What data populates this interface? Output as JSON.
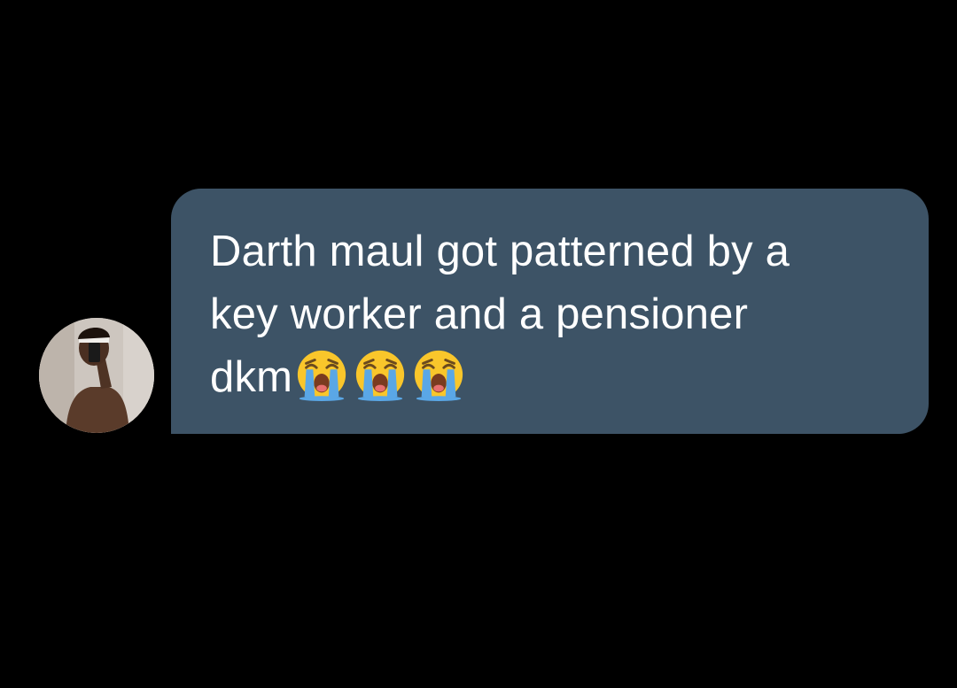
{
  "message": {
    "lines": [
      "Darth maul got patterned by a",
      "key worker and a pensioner",
      "dkm"
    ],
    "emojis": [
      "loudly-crying-face",
      "loudly-crying-face",
      "loudly-crying-face"
    ],
    "bubble_color": "#3d5366",
    "text_color": "#ffffff"
  },
  "background_color": "#000000"
}
